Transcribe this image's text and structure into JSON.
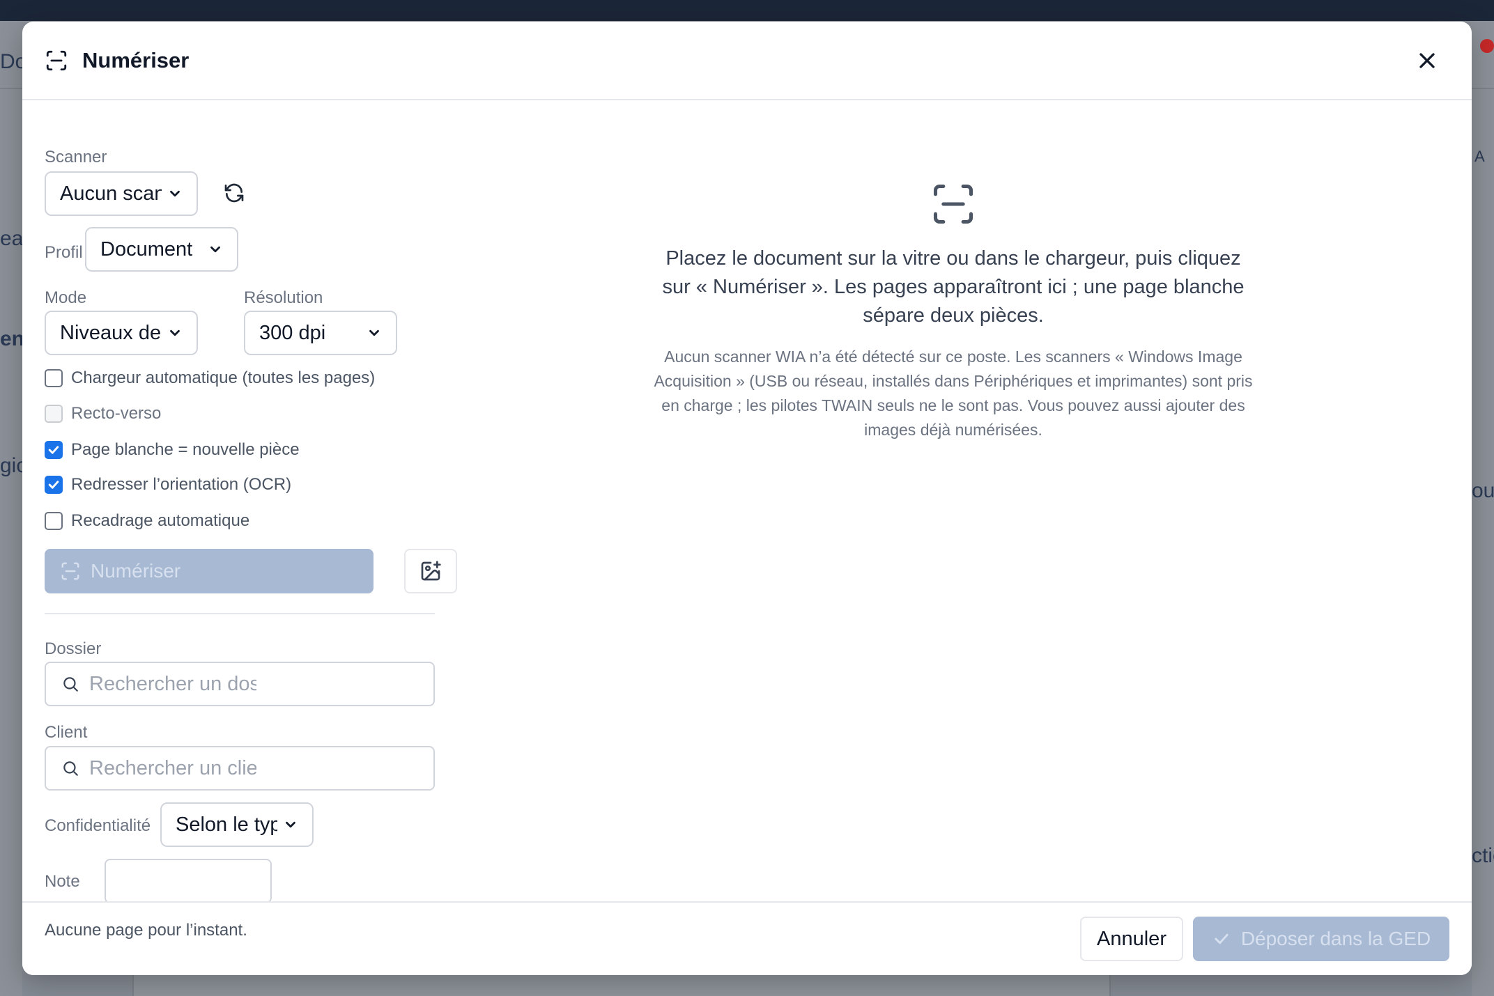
{
  "modal": {
    "title": "Numériser",
    "close_icon": "close-icon"
  },
  "background": {
    "left_fragments": [
      "Do",
      "eau",
      "ent",
      "gic"
    ],
    "right_fragments": [
      "A",
      "our",
      "ctio"
    ]
  },
  "form": {
    "scanner": {
      "label": "Scanner",
      "value": "Aucun scanner"
    },
    "profile": {
      "label": "Profil",
      "value": "Document"
    },
    "mode": {
      "label": "Mode",
      "value": "Niveaux de gris"
    },
    "resolution": {
      "label": "Résolution",
      "value": "300 dpi"
    },
    "options": [
      {
        "label": "Chargeur automatique (toutes les pages)",
        "checked": false,
        "disabled": false
      },
      {
        "label": "Recto-verso",
        "checked": false,
        "disabled": true
      },
      {
        "label": "Page blanche = nouvelle pièce",
        "checked": true,
        "disabled": false
      },
      {
        "label": "Redresser l’orientation (OCR)",
        "checked": true,
        "disabled": false
      },
      {
        "label": "Recadrage automatique",
        "checked": false,
        "disabled": false
      }
    ],
    "scan_button": "Numériser",
    "folder": {
      "label": "Dossier",
      "placeholder": "Rechercher un dossier"
    },
    "client": {
      "label": "Client",
      "placeholder": "Rechercher un client"
    },
    "confidentiality": {
      "label": "Confidentialité",
      "value": "Selon le type"
    },
    "note": {
      "label": "Note",
      "value": ""
    }
  },
  "preview": {
    "message": "Placez le document sur la vitre ou dans le chargeur, puis cliquez sur « Numériser ». Les pages apparaîtront ici ; une page blanche sépare deux pièces.",
    "info": "Aucun scanner WIA n’a été détecté sur ce poste. Les scanners « Windows Image Acquisition » (USB ou réseau, installés dans Périphériques et imprimantes) sont pris en charge ; les pilotes TWAIN seuls ne le sont pas. Vous pouvez aussi ajouter des images déjà numérisées."
  },
  "footer": {
    "status": "Aucune page pour l’instant.",
    "cancel": "Annuler",
    "submit": "Déposer dans la GED"
  },
  "colors": {
    "accent": "#1a73e8",
    "disabled_button": "#a8b9d4",
    "title": "#111827"
  }
}
